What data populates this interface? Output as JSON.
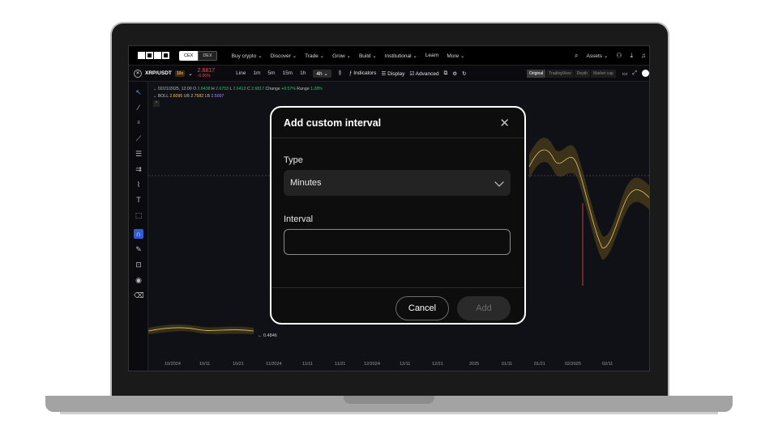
{
  "topnav": {
    "seg_cex": "CEX",
    "seg_dex": "DEX",
    "links": [
      "Buy crypto ⌄",
      "Discover ⌄",
      "Trade ⌄",
      "Grow ⌄",
      "Build ⌄",
      "Institutional ⌄",
      "Learn",
      "More ⌄"
    ],
    "assets": "Assets ⌄"
  },
  "ticker": {
    "pair": "XRP/USDT",
    "leverage": "10x",
    "price": "2.6817",
    "change": "-0.06%",
    "intervals": [
      "Line",
      "1m",
      "5m",
      "15m",
      "1h",
      "4h ⌄"
    ],
    "indicators": "Indicators",
    "display": "Display",
    "advanced": "Advanced",
    "views": [
      "Original",
      "TradingView",
      "Depth",
      "Market cap"
    ]
  },
  "chart": {
    "ohlc_line": {
      "date": "02/21/2025, 12:00",
      "o_label": "O",
      "o": "2.6438",
      "h_label": "H",
      "h": "2.6753",
      "l_label": "L",
      "l": "2.6413",
      "c_label": "C",
      "c": "2.6817",
      "change_label": "Change",
      "change": "+0.57%",
      "range_label": "Range",
      "range": "1.28%"
    },
    "boll_line": {
      "name": "BOLL",
      "mid": "2.6095",
      "ub_label": "UB",
      "ub": "2.7582",
      "lb_label": "LB",
      "lb": "2.5007"
    },
    "low_marker": "← 0.4846",
    "x_ticks": [
      "10/2024",
      "10/11",
      "10/21",
      "11/2024",
      "11/11",
      "11/21",
      "12/2024",
      "12/11",
      "12/21",
      "2025",
      "01/11",
      "01/21",
      "02/2025",
      "02/11"
    ]
  },
  "dialog": {
    "title": "Add custom interval",
    "type_label": "Type",
    "type_value": "Minutes",
    "interval_label": "Interval",
    "interval_value": "",
    "cancel": "Cancel",
    "add": "Add"
  }
}
